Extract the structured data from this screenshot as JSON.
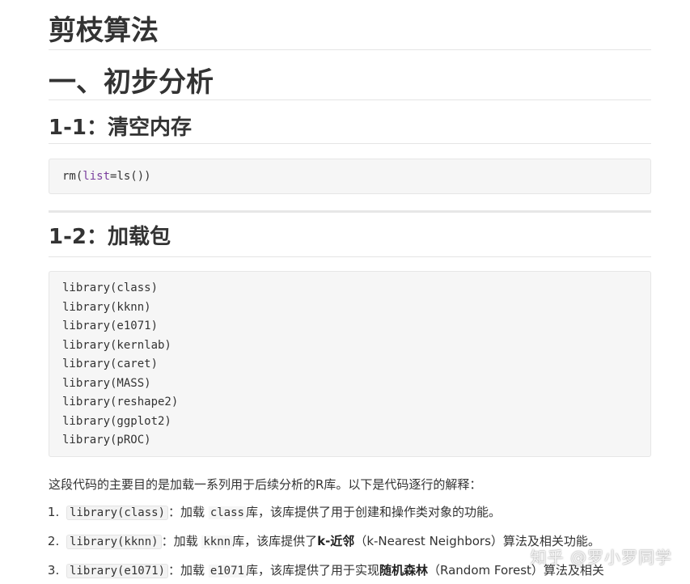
{
  "title": "剪枝算法",
  "section1": {
    "title": "一、初步分析",
    "sub1": {
      "title": "1-1：清空内存",
      "code": {
        "fn": "rm(",
        "kw": "list",
        "rest": "=ls())"
      }
    },
    "sub2": {
      "title": "1-2：加载包",
      "code_lines": [
        "library(class)",
        "library(kknn)",
        "library(e1071)",
        "library(kernlab)",
        "library(caret)",
        "library(MASS)",
        "library(reshape2)",
        "library(ggplot2)",
        "library(pROC)"
      ]
    }
  },
  "intro": "这段代码的主要目的是加载一系列用于后续分析的R库。以下是代码逐行的解释：",
  "list": [
    {
      "code": "library(class)",
      "sep": "：加载",
      "pkg": "class",
      "text": "库，该库提供了用于创建和操作类对象的功能。"
    },
    {
      "code": "library(kknn)",
      "sep": "：加载",
      "pkg": "kknn",
      "text_a": "库，该库提供了",
      "bold": "k-近邻",
      "text_b": "（k-Nearest Neighbors）算法及相关功能。"
    },
    {
      "code": "library(e1071)",
      "sep": "：加载",
      "pkg": "e1071",
      "text_a": "库，该库提供了用于实现",
      "bold": "随机森林",
      "text_b": "（Random Forest）算法及相关"
    }
  ],
  "watermark": "知乎 @罗小罗同学"
}
